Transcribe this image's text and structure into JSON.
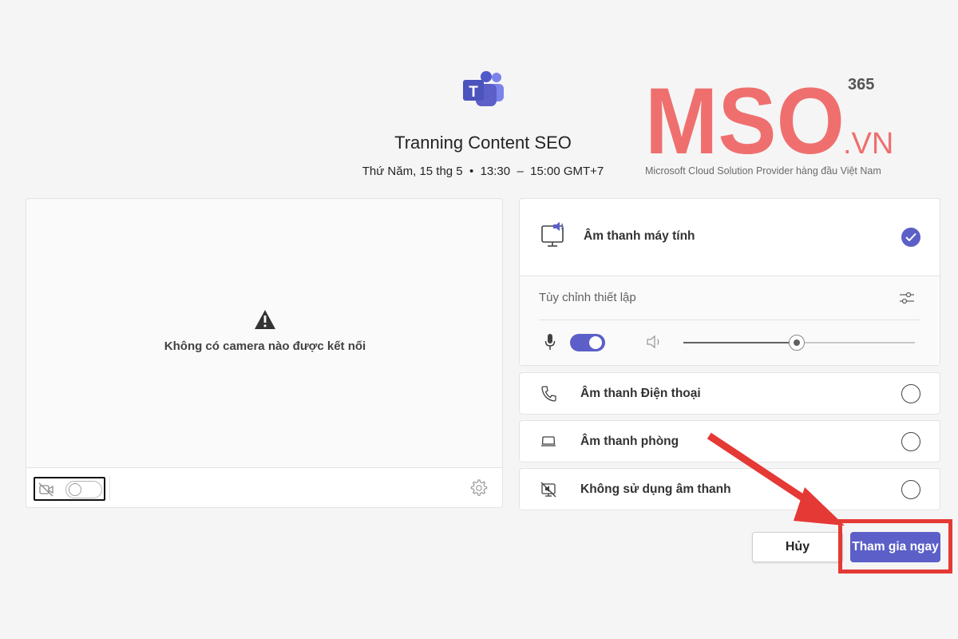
{
  "meeting": {
    "title": "Tranning Content SEO",
    "time": "Thứ Năm, 15 thg 5  •  13:30  –  15:00 GMT+7"
  },
  "watermark": {
    "brand": "MSO",
    "superscript": "365",
    "domain": ".VN",
    "tagline": "Microsoft Cloud Solution Provider hàng đầu Việt Nam"
  },
  "video": {
    "no_camera_message": "Không có camera nào được kết nối",
    "camera_enabled": false
  },
  "audio": {
    "computer_label": "Âm thanh máy tính",
    "computer_selected": true,
    "custom_settings_label": "Tùy chỉnh thiết lập",
    "mic_enabled": true,
    "speaker_volume": 0.49,
    "options": [
      {
        "label": "Âm thanh Điện thoại",
        "icon": "phone-icon",
        "selected": false
      },
      {
        "label": "Âm thanh phòng",
        "icon": "room-audio-icon",
        "selected": false
      },
      {
        "label": "Không sử dụng âm thanh",
        "icon": "no-audio-icon",
        "selected": false
      }
    ]
  },
  "actions": {
    "cancel_label": "Hủy",
    "join_label": "Tham gia ngay"
  },
  "colors": {
    "accent": "#5b5fc7",
    "annotation": "#e53935",
    "watermark": "#ef6f6f"
  }
}
